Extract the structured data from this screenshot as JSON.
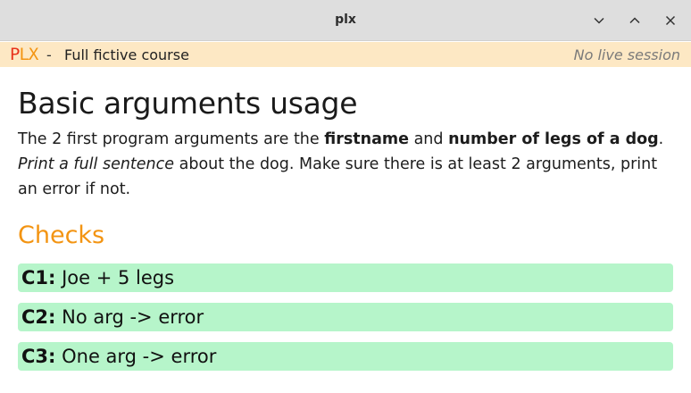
{
  "window": {
    "title": "plx",
    "buttons": [
      "chevron-down-icon",
      "chevron-up-icon",
      "close-icon"
    ]
  },
  "header": {
    "logo_letters": [
      "P",
      "L",
      "X"
    ],
    "logo_colors": [
      "#e8321b",
      "#f39412",
      "#f39412"
    ],
    "separator": "-",
    "course": "Full fictive course",
    "session_status": "No live session",
    "background": "#fde8c4"
  },
  "exercise": {
    "title": "Basic arguments usage",
    "instructions": {
      "t1": "The 2 first program arguments are the ",
      "b1": "firstname",
      "t2": " and ",
      "b2": "number of legs of a dog",
      "t3": ".",
      "i1": "Print a full sentence",
      "t4": " about the dog. Make sure there is at least 2 arguments, print an error if not."
    }
  },
  "checks": {
    "title": "Checks",
    "color": "#f39412",
    "pass_color": "#b6f5ca",
    "items": [
      {
        "id": "C1:",
        "name": "Joe + 5 legs"
      },
      {
        "id": "C2:",
        "name": "No arg -> error"
      },
      {
        "id": "C3:",
        "name": "One arg -> error"
      }
    ]
  }
}
